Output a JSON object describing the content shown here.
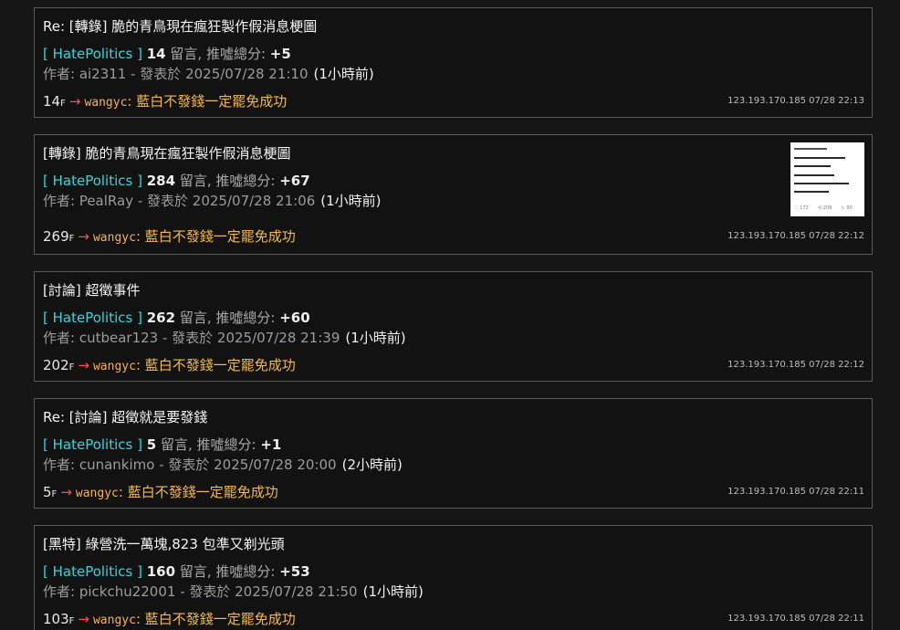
{
  "posts": [
    {
      "title": "Re: [轉錄] 脆的青鳥現在瘋狂製作假消息梗圖",
      "board": "[ HatePolitics ]",
      "comments": "14",
      "comments_label": "留言, 推噓總分:",
      "score": "+5",
      "author_line": "作者: ai2311 - 發表於 2025/07/28 21:10",
      "ago": "(1小時前)",
      "floor": "14",
      "floor_suffix": "F",
      "arrow": "→",
      "push_user": "wangyc",
      "push_text": "藍白不發錢一定罷免成功",
      "ip_date": "123.193.170.185 07/28 22:13"
    },
    {
      "title": "[轉錄] 脆的青鳥現在瘋狂製作假消息梗圖",
      "board": "[ HatePolitics ]",
      "comments": "284",
      "comments_label": "留言, 推噓總分:",
      "score": "+67",
      "author_line": "作者: PealRay - 發表於 2025/07/28 21:06",
      "ago": "(1小時前)",
      "floor": "269",
      "floor_suffix": "F",
      "arrow": "→",
      "push_user": "wangyc",
      "push_text": "藍白不發錢一定罷免成功",
      "ip_date": "123.193.170.185 07/28 22:12"
    },
    {
      "title": "[討論] 超徵事件",
      "board": "[ HatePolitics ]",
      "comments": "262",
      "comments_label": "留言, 推噓總分:",
      "score": "+60",
      "author_line": "作者: cutbear123 - 發表於 2025/07/28 21:39",
      "ago": "(1小時前)",
      "floor": "202",
      "floor_suffix": "F",
      "arrow": "→",
      "push_user": "wangyc",
      "push_text": "藍白不發錢一定罷免成功",
      "ip_date": "123.193.170.185 07/28 22:12"
    },
    {
      "title": "Re: [討論] 超徵就是要發錢",
      "board": "[ HatePolitics ]",
      "comments": "5",
      "comments_label": "留言, 推噓總分:",
      "score": "+1",
      "author_line": "作者: cunankimo - 發表於 2025/07/28 20:00",
      "ago": "(2小時前)",
      "floor": "5",
      "floor_suffix": "F",
      "arrow": "→",
      "push_user": "wangyc",
      "push_text": "藍白不發錢一定罷免成功",
      "ip_date": "123.193.170.185 07/28 22:11"
    },
    {
      "title": "[黑特] 綠營洗一萬塊,823 包準又剃光頭",
      "board": "[ HatePolitics ]",
      "comments": "160",
      "comments_label": "留言, 推噓總分:",
      "score": "+53",
      "author_line": "作者: pickchu22001 - 發表於 2025/07/28 21:50",
      "ago": "(1小時前)",
      "floor": "103",
      "floor_suffix": "F",
      "arrow": "→",
      "push_user": "wangyc",
      "push_text": "藍白不發錢一定罷免成功",
      "ip_date": "123.193.170.185 07/28 22:11"
    }
  ],
  "thumbnail_icon": "social-post-screenshot-thumbnail"
}
